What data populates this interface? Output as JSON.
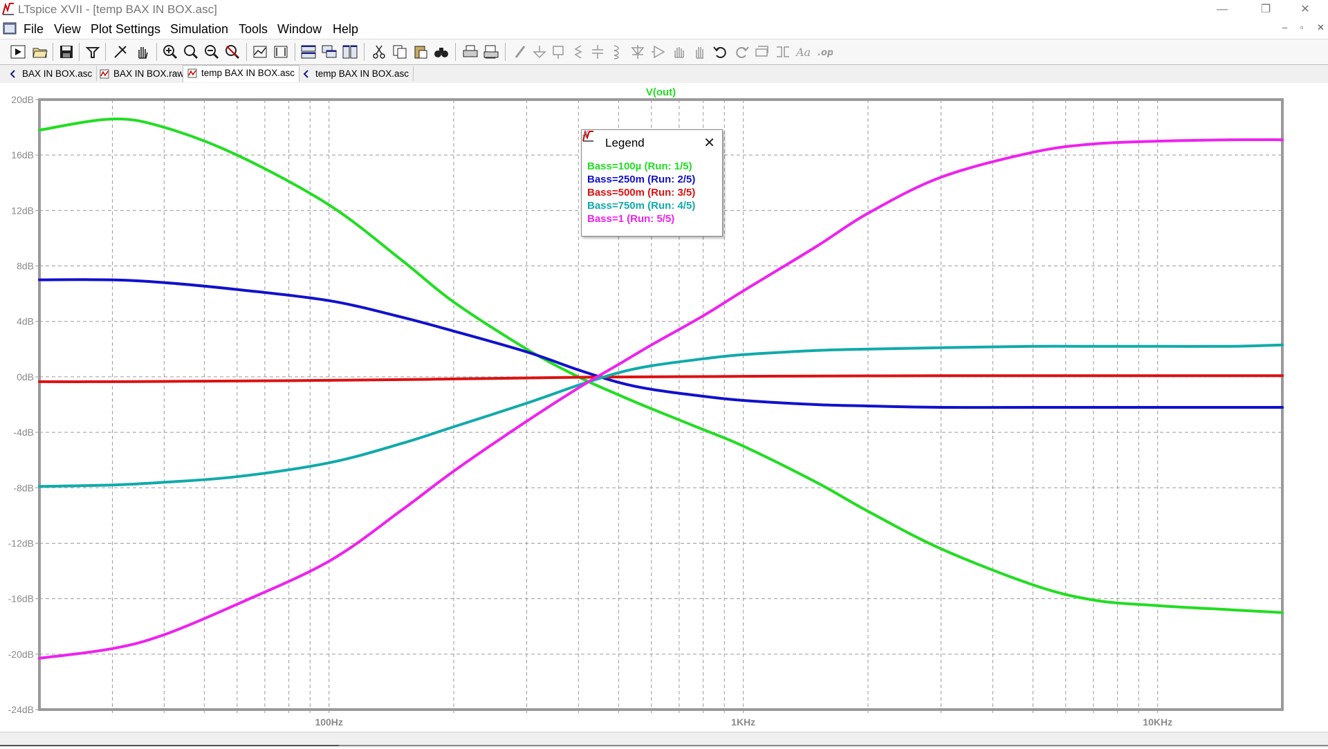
{
  "window": {
    "title": "LTspice XVII - [temp BAX IN BOX.asc]",
    "controls": [
      "—",
      "❐",
      "✕"
    ]
  },
  "menu": {
    "items": [
      "File",
      "View",
      "Plot Settings",
      "Simulation",
      "Tools",
      "Window",
      "Help"
    ],
    "mdi_controls": [
      "–",
      "▫",
      "✕"
    ]
  },
  "toolbar": {
    "icons": [
      "run-icon",
      "open-icon",
      "save-icon",
      "control-panel-icon",
      "halt-icon",
      "pan-hand-icon",
      "zoom-in-icon",
      "zoom-area-icon",
      "zoom-out-icon",
      "zoom-cancel-icon",
      "autorange-icon",
      "zoom-extents-icon",
      "tile-horizontal-icon",
      "cascade-icon",
      "tile-vertical-icon",
      "cut-icon",
      "copy-icon",
      "paste-icon",
      "find-icon",
      "print-icon",
      "print-preview-icon",
      "draw-wire-icon",
      "ground-icon",
      "label-net-icon",
      "resistor-icon",
      "capacitor-icon",
      "inductor-icon",
      "diode-icon",
      "component-icon",
      "move-icon",
      "drag-icon",
      "undo-icon",
      "redo-icon",
      "rotate-icon",
      "mirror-icon",
      "text-icon",
      "spice-directive-icon"
    ]
  },
  "tabs": [
    {
      "label": "BAX IN BOX.asc",
      "icon": "schematic-icon",
      "active": false
    },
    {
      "label": "BAX IN BOX.raw",
      "icon": "waveform-icon",
      "active": false
    },
    {
      "label": "temp BAX IN BOX.asc",
      "icon": "waveform-icon",
      "active": true
    },
    {
      "label": "temp BAX IN BOX.asc",
      "icon": "schematic-icon",
      "active": false
    }
  ],
  "legend": {
    "title": "Legend",
    "entries": [
      {
        "text": "Bass=100µ  (Run: 1/5)",
        "color": "#22dd22"
      },
      {
        "text": "Bass=250m  (Run: 2/5)",
        "color": "#1111cc"
      },
      {
        "text": "Bass=500m  (Run: 3/5)",
        "color": "#dd1111"
      },
      {
        "text": "Bass=750m  (Run: 4/5)",
        "color": "#11aaaa"
      },
      {
        "text": "Bass=1  (Run: 5/5)",
        "color": "#ee22ee"
      }
    ]
  },
  "chart_data": {
    "type": "line",
    "title": "V(out)",
    "x_scale": "log",
    "xlim": [
      20,
      20000
    ],
    "ylim": [
      -24,
      20
    ],
    "x_ticks": [
      {
        "value": 100,
        "label": "100Hz"
      },
      {
        "value": 1000,
        "label": "1KHz"
      },
      {
        "value": 10000,
        "label": "10KHz"
      }
    ],
    "y_ticks": [
      {
        "value": 20,
        "label": "20dB"
      },
      {
        "value": 16,
        "label": "16dB"
      },
      {
        "value": 12,
        "label": "12dB"
      },
      {
        "value": 8,
        "label": "8dB"
      },
      {
        "value": 4,
        "label": "4dB"
      },
      {
        "value": 0,
        "label": "0dB"
      },
      {
        "value": -4,
        "label": "-4dB"
      },
      {
        "value": -8,
        "label": "-8dB"
      },
      {
        "value": -12,
        "label": "-12dB"
      },
      {
        "value": -16,
        "label": "-16dB"
      },
      {
        "value": -20,
        "label": "-20dB"
      },
      {
        "value": -24,
        "label": "-24dB"
      }
    ],
    "grid": true,
    "x": [
      20,
      30,
      40,
      60,
      100,
      150,
      200,
      300,
      400,
      500,
      600,
      800,
      1000,
      1500,
      2000,
      3000,
      5000,
      7000,
      10000,
      15000,
      20000
    ],
    "series": [
      {
        "name": "Bass=100µ  (Run: 1/5)",
        "color": "#22dd22",
        "values": [
          17.8,
          18.6,
          18.0,
          16.0,
          12.4,
          8.4,
          5.4,
          2.0,
          0.0,
          -1.3,
          -2.3,
          -3.8,
          -5.0,
          -7.6,
          -9.7,
          -12.4,
          -15.0,
          -16.1,
          -16.5,
          -16.8,
          -17.0
        ]
      },
      {
        "name": "Bass=250m  (Run: 2/5)",
        "color": "#1111cc",
        "values": [
          7.0,
          7.0,
          6.8,
          6.3,
          5.5,
          4.3,
          3.3,
          1.8,
          0.5,
          -0.4,
          -0.9,
          -1.4,
          -1.7,
          -2.0,
          -2.1,
          -2.2,
          -2.2,
          -2.2,
          -2.2,
          -2.2,
          -2.2
        ]
      },
      {
        "name": "Bass=500m  (Run: 3/5)",
        "color": "#dd1111",
        "values": [
          -0.35,
          -0.35,
          -0.33,
          -0.3,
          -0.25,
          -0.2,
          -0.15,
          -0.08,
          -0.03,
          -0.01,
          0.0,
          0.02,
          0.04,
          0.06,
          0.07,
          0.08,
          0.08,
          0.08,
          0.08,
          0.08,
          0.08
        ]
      },
      {
        "name": "Bass=750m  (Run: 4/5)",
        "color": "#11aaaa",
        "values": [
          -7.9,
          -7.8,
          -7.6,
          -7.2,
          -6.2,
          -4.8,
          -3.6,
          -1.9,
          -0.6,
          0.3,
          0.8,
          1.3,
          1.6,
          1.9,
          2.0,
          2.1,
          2.2,
          2.2,
          2.2,
          2.2,
          2.3
        ]
      },
      {
        "name": "Bass=1  (Run: 5/5)",
        "color": "#ee22ee",
        "values": [
          -20.3,
          -19.6,
          -18.6,
          -16.4,
          -13.3,
          -9.6,
          -6.8,
          -3.2,
          -0.8,
          0.9,
          2.3,
          4.4,
          6.2,
          9.4,
          11.8,
          14.4,
          16.2,
          16.8,
          17.0,
          17.1,
          17.1
        ]
      }
    ]
  }
}
